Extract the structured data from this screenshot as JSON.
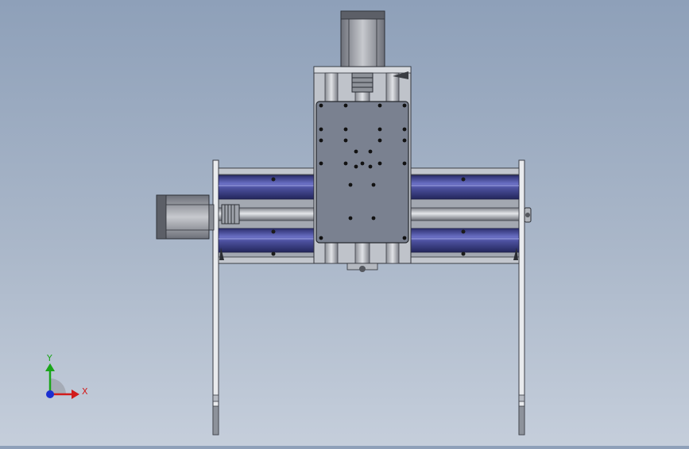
{
  "viewport": {
    "background_top": "#8ea0b9",
    "background_bottom": "#c5cedb"
  },
  "model": {
    "frame_color": "#9aa0aa",
    "rail_color": "#4b4f9c",
    "plate_color": "#757c8a",
    "shaft_color": "#c9ccd2"
  },
  "triad": {
    "x_label": "X",
    "y_label": "Y",
    "x_color": "#d11b1b",
    "y_color": "#1aa51a",
    "z_color": "#1b2fd1"
  }
}
